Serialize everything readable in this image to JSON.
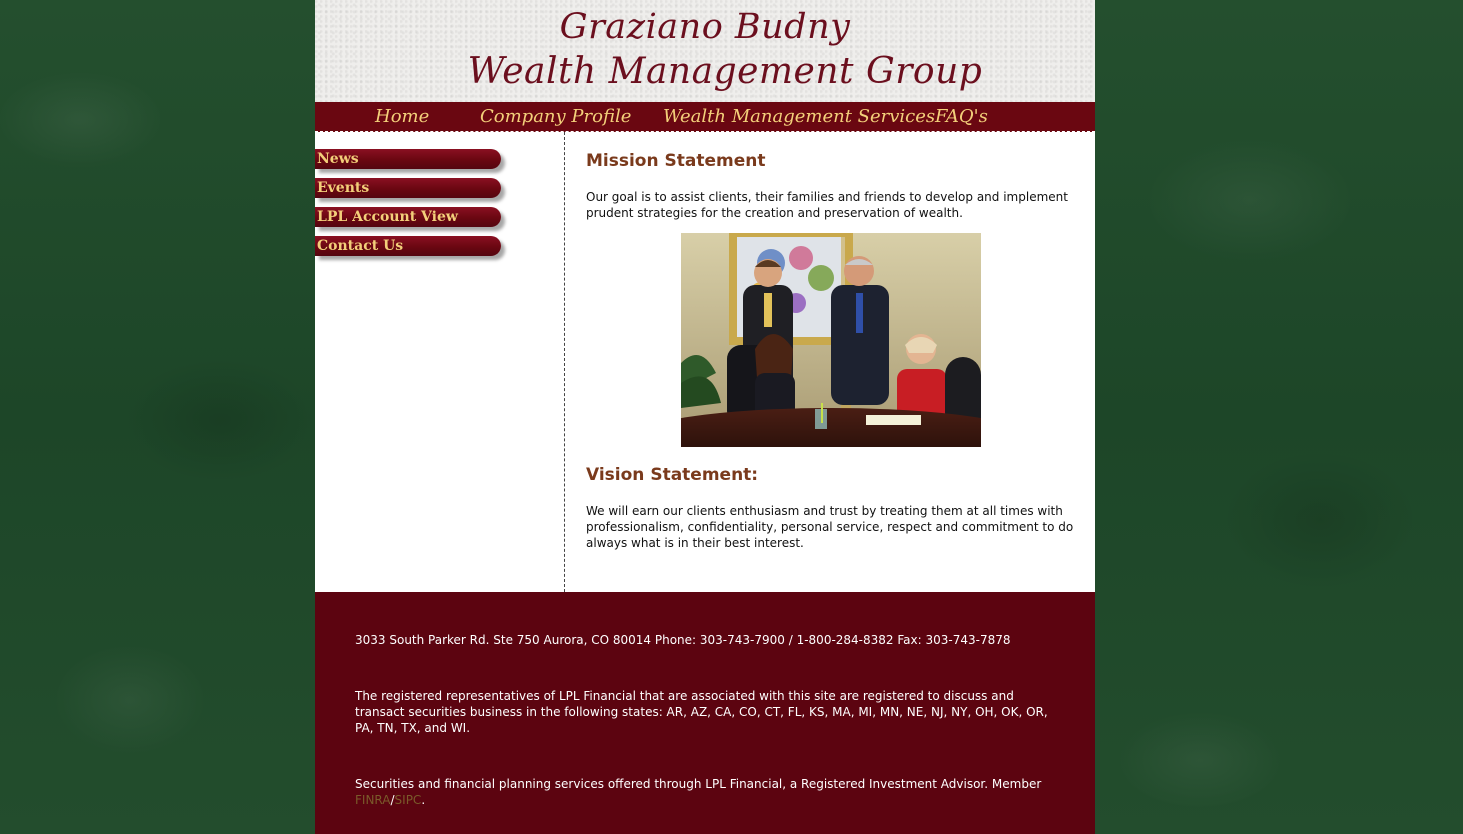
{
  "header": {
    "logo_line1": "Graziano Budny",
    "logo_line2": "Wealth Management Group"
  },
  "topnav": {
    "items": [
      {
        "label": "Home"
      },
      {
        "label": "Company Profile"
      },
      {
        "label": "Wealth Management Services"
      },
      {
        "label": "FAQ's"
      }
    ]
  },
  "sidebar": {
    "items": [
      {
        "label": "News"
      },
      {
        "label": "Events"
      },
      {
        "label": "LPL Account View"
      },
      {
        "label": "Contact Us"
      }
    ]
  },
  "main": {
    "mission_title": "Mission Statement",
    "mission_text": "Our goal is to assist clients, their families and friends to develop and implement prudent strategies for the creation and preservation of wealth.",
    "vision_title": "Vision Statement:",
    "vision_text": "We will earn our clients enthusiasm and trust by treating them at all times with professionalism, confidentiality, personal service, respect and commitment to do always what is in their best interest."
  },
  "footer": {
    "address": "3033 South Parker Rd. Ste 750 Aurora, CO 80014 Phone: 303-743-7900 / 1-800-284-8382 Fax: 303-743-7878",
    "registration": "The registered representatives of LPL Financial that are associated with this site are registered to discuss and transact securities business in the following states: AR, AZ, CA, CO, CT, FL, KS, MA, MI, MN, NE, NJ, NY, OH, OK, OR, PA, TN, TX, and WI.",
    "securities_text": "Securities and financial planning services offered through LPL Financial, a Registered Investment Advisor. Member",
    "finra_link": "FINRA",
    "separator": "/",
    "sipc_link": "SIPC",
    "end_punct": "."
  },
  "colors": {
    "brand_maroon": "#6a0711",
    "nav_text": "#f3cf7a",
    "heading_brown": "#7a3a1c",
    "background_green": "#1f4a2a"
  }
}
